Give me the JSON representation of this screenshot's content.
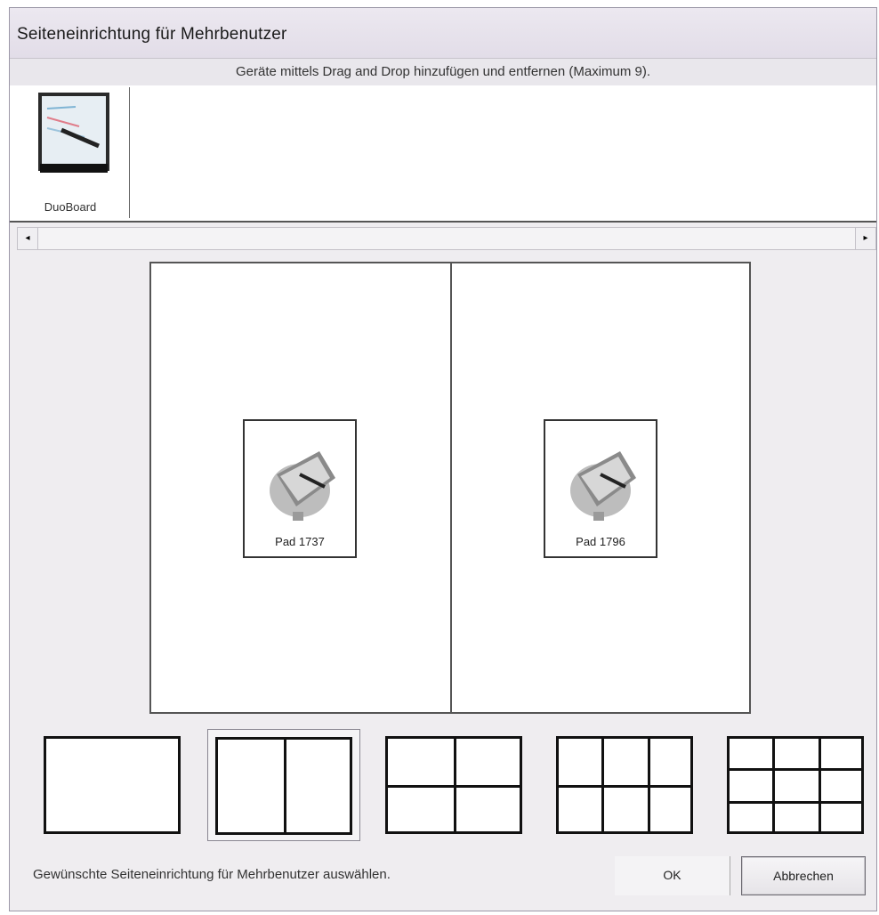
{
  "window": {
    "title": "Seiteneinrichtung für Mehrbenutzer",
    "instruction": "Geräte mittels Drag and Drop hinzufügen und entfernen (Maximum 9)."
  },
  "tray": {
    "devices": [
      {
        "label": "DuoBoard",
        "icon": "duoboard-device-icon"
      }
    ]
  },
  "scrollbar": {
    "left_arrow": "◂",
    "right_arrow": "▸"
  },
  "preview": {
    "slots": [
      {
        "label": "Pad 1737",
        "icon": "pen-pad-icon"
      },
      {
        "label": "Pad 1796",
        "icon": "pen-pad-icon"
      }
    ]
  },
  "layouts": {
    "options": [
      {
        "name": "1",
        "selected": false
      },
      {
        "name": "2",
        "selected": true
      },
      {
        "name": "4",
        "selected": false
      },
      {
        "name": "6",
        "selected": false
      },
      {
        "name": "9",
        "selected": false
      }
    ]
  },
  "footer": {
    "status": "Gewünschte Seiteneinrichtung für Mehrbenutzer auswählen.",
    "ok_label": "OK",
    "cancel_label": "Abbrechen"
  }
}
